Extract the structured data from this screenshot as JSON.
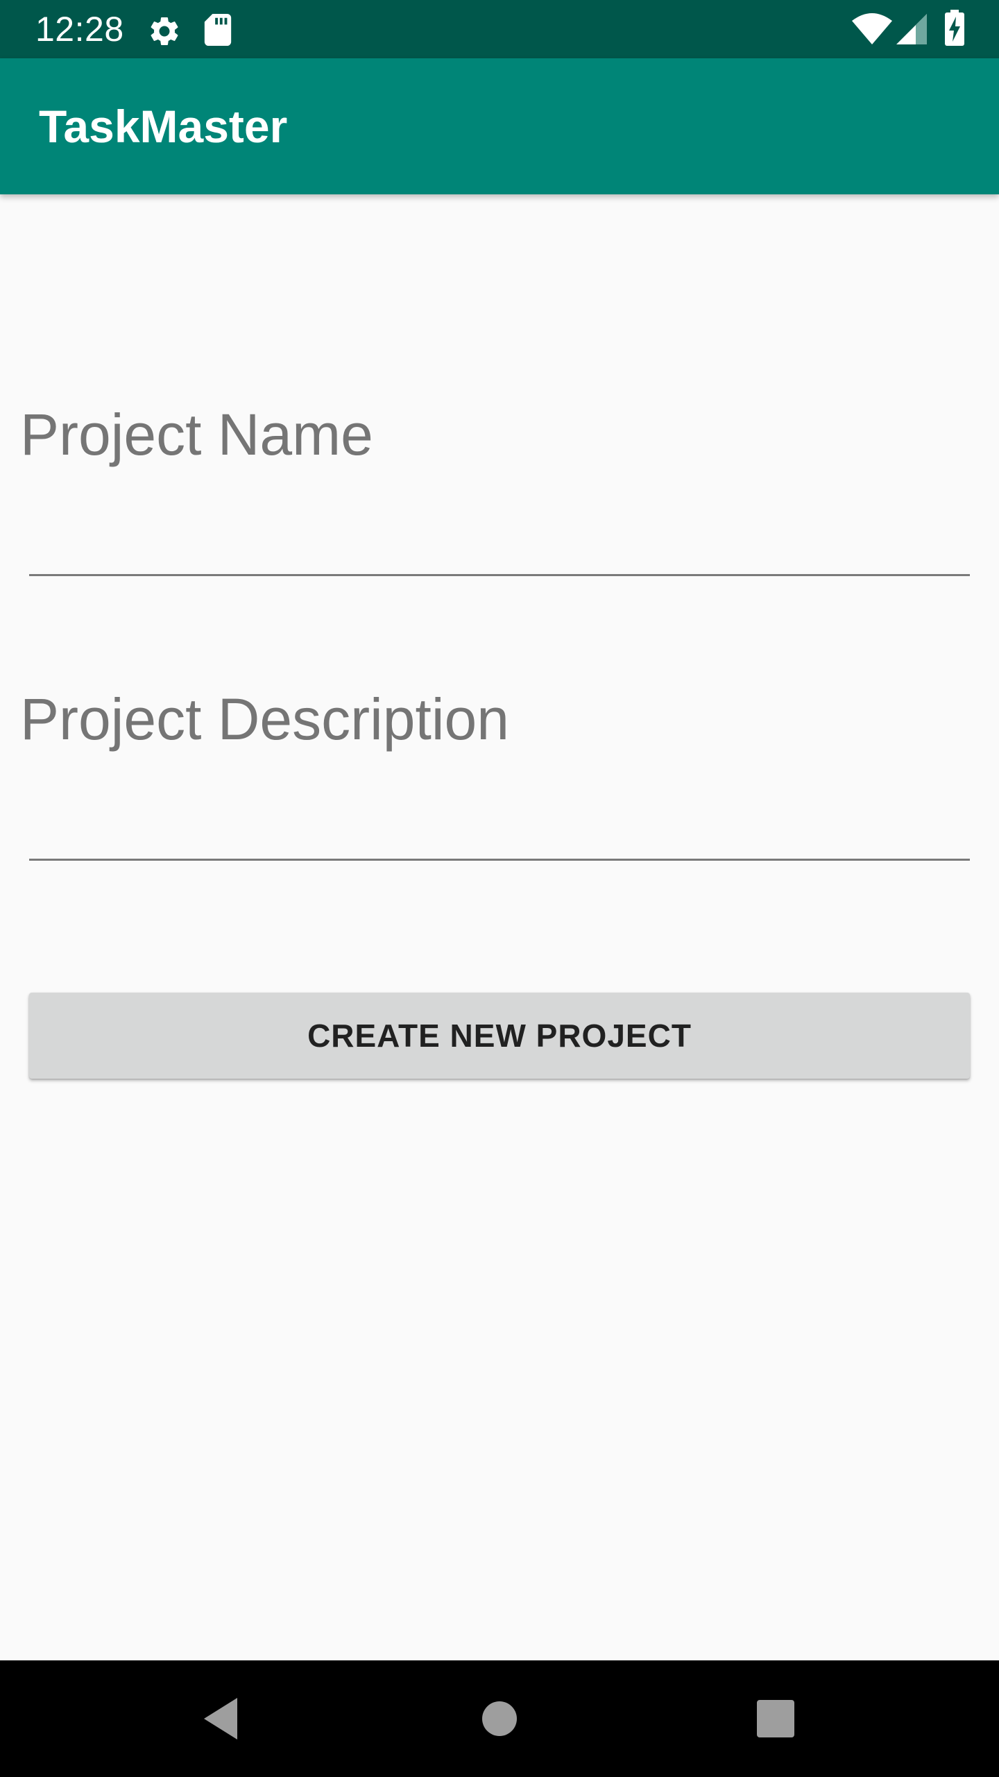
{
  "status_bar": {
    "time": "12:28",
    "icons": [
      "settings-gear-icon",
      "sd-card-icon",
      "wifi-icon",
      "cellular-signal-icon",
      "battery-charging-icon"
    ]
  },
  "app_bar": {
    "title": "TaskMaster"
  },
  "form": {
    "project_name": {
      "placeholder": "Project Name",
      "value": ""
    },
    "project_description": {
      "placeholder": "Project Description",
      "value": ""
    },
    "create_button_label": "CREATE NEW PROJECT"
  },
  "nav_bar": {
    "buttons": [
      "back-icon",
      "home-icon",
      "recents-icon"
    ]
  },
  "colors": {
    "status_bar": "#00574B",
    "app_bar": "#008577",
    "background": "#FAFAFA",
    "button": "#D6D7D7",
    "placeholder_text": "#757575"
  }
}
